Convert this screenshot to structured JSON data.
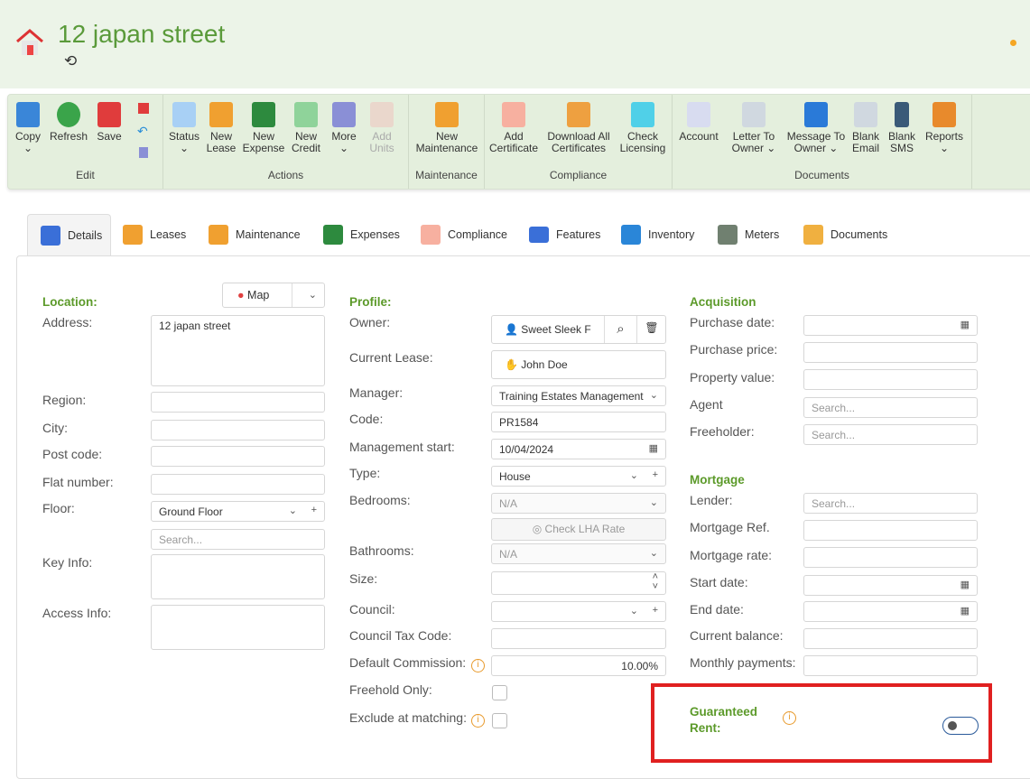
{
  "header": {
    "title": "12 japan street",
    "icon": "home-icon",
    "history_icon": "history-icon",
    "status_dot_color": "#f5a623"
  },
  "ribbon": {
    "groups": [
      {
        "label": "Edit",
        "buttons": [
          {
            "label": "Copy",
            "icon": "copy-icon"
          },
          {
            "label": "Refresh",
            "icon": "refresh-icon"
          },
          {
            "label": "Save",
            "icon": "save-icon"
          }
        ],
        "small": [
          "save-small-icon",
          "undo-icon",
          "delete-icon"
        ]
      },
      {
        "label": "Actions",
        "buttons": [
          {
            "label": "Status",
            "icon": "flag-icon"
          },
          {
            "label": "New Lease",
            "icon": "lease-icon"
          },
          {
            "label": "New Expense",
            "icon": "expense-icon"
          },
          {
            "label": "New Credit",
            "icon": "credit-icon"
          },
          {
            "label": "More",
            "icon": "more-icon"
          },
          {
            "label": "Add Units",
            "icon": "add-units-icon"
          }
        ]
      },
      {
        "label": "Maintenance",
        "buttons": [
          {
            "label": "New Maintenance",
            "icon": "maintenance-icon"
          }
        ]
      },
      {
        "label": "Compliance",
        "buttons": [
          {
            "label": "Add Certificate",
            "icon": "certificate-icon"
          },
          {
            "label": "Download All Certificates",
            "icon": "folder-download-icon"
          },
          {
            "label": "Check Licensing",
            "icon": "licensing-icon"
          }
        ]
      },
      {
        "label": "Documents",
        "buttons": [
          {
            "label": "Account",
            "icon": "account-book-icon"
          },
          {
            "label": "Letter To Owner",
            "icon": "letter-icon"
          },
          {
            "label": "Message To Owner",
            "icon": "message-icon"
          },
          {
            "label": "Blank Email",
            "icon": "email-icon"
          },
          {
            "label": "Blank SMS",
            "icon": "sms-icon"
          },
          {
            "label": "Reports",
            "icon": "reports-icon"
          }
        ]
      }
    ]
  },
  "tabs": [
    "Details",
    "Leases",
    "Maintenance",
    "Expenses",
    "Compliance",
    "Features",
    "Inventory",
    "Meters",
    "Documents"
  ],
  "location": {
    "heading": "Location:",
    "map": "Map",
    "address_label": "Address:",
    "address": "12 japan street",
    "region": "Region:",
    "city": "City:",
    "postcode": "Post code:",
    "flat": "Flat number:",
    "floor": "Floor:",
    "floor_value": "Ground Floor",
    "search_ph": "Search...",
    "key_info": "Key Info:",
    "access_info": "Access Info:"
  },
  "profile": {
    "heading": "Profile:",
    "owner": "Owner:",
    "owner_value": "Sweet Sleek F",
    "current_lease": "Current Lease:",
    "lease_value": "John Doe",
    "manager": "Manager:",
    "manager_value": "Training Estates Management",
    "code": "Code:",
    "code_value": "PR1584",
    "mgmt_start": "Management start:",
    "mgmt_start_value": "10/04/2024",
    "type": "Type:",
    "type_value": "House",
    "bedrooms": "Bedrooms:",
    "bedrooms_value": "N/A",
    "check_lha": "Check LHA Rate",
    "bathrooms": "Bathrooms:",
    "bathrooms_value": "N/A",
    "size": "Size:",
    "council": "Council:",
    "council_tax": "Council Tax Code:",
    "commission": "Default Commission:",
    "commission_value": "10.00%",
    "freehold": "Freehold Only:",
    "exclude": "Exclude at matching:"
  },
  "acquisition": {
    "heading": "Acquisition",
    "purchase_date": "Purchase date:",
    "purchase_price": "Purchase price:",
    "property_value": "Property value:",
    "agent": "Agent",
    "freeholder": "Freeholder:",
    "search_ph": "Search..."
  },
  "mortgage": {
    "heading": "Mortgage",
    "lender": "Lender:",
    "ref": "Mortgage Ref.",
    "rate": "Mortgage rate:",
    "start": "Start date:",
    "end": "End date:",
    "balance": "Current balance:",
    "monthly": "Monthly payments:",
    "search_ph": "Search..."
  },
  "guaranteed": {
    "label1": "Guaranteed",
    "label2": "Rent:",
    "enabled": false,
    "highlight_color": "#e02020"
  }
}
